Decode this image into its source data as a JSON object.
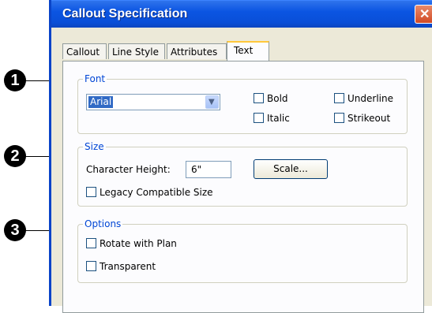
{
  "window": {
    "title": "Callout Specification",
    "close_glyph": "✕"
  },
  "markers": [
    "1",
    "2",
    "3"
  ],
  "tabs": [
    {
      "label": "Callout",
      "active": false
    },
    {
      "label": "Line Style",
      "active": false
    },
    {
      "label": "Attributes",
      "active": false
    },
    {
      "label": "Text",
      "active": true
    }
  ],
  "font_group": {
    "legend": "Font",
    "font_value": "Arial",
    "dropdown_icon": "chevron-down-icon",
    "bold": {
      "label": "Bold",
      "checked": false
    },
    "italic": {
      "label": "Italic",
      "checked": false
    },
    "underline": {
      "label": "Underline",
      "checked": false
    },
    "strikeout": {
      "label": "Strikeout",
      "checked": false
    }
  },
  "size_group": {
    "legend": "Size",
    "char_height_label": "Character Height:",
    "char_height_value": "6\"",
    "scale_button": "Scale...",
    "legacy": {
      "label": "Legacy Compatible Size",
      "checked": false
    }
  },
  "options_group": {
    "legend": "Options",
    "rotate": {
      "label": "Rotate with Plan",
      "checked": false
    },
    "transparent": {
      "label": "Transparent",
      "checked": false
    }
  },
  "colors": {
    "titlebar": "#0b55e2",
    "legend_text": "#0046d5",
    "active_tab_highlight": "#ffc83c"
  }
}
